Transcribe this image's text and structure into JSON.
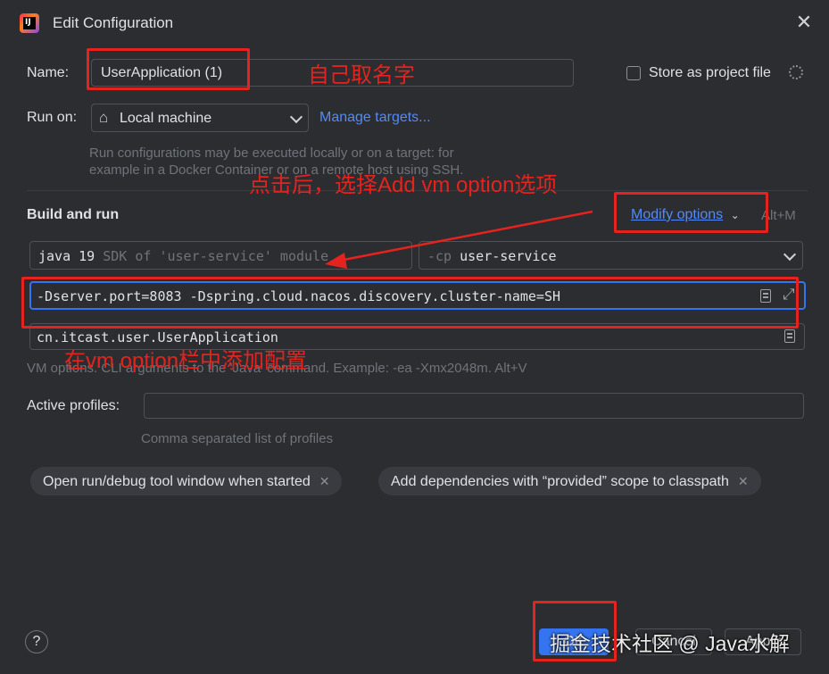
{
  "window": {
    "title": "Edit Configuration"
  },
  "name": {
    "label": "Name:",
    "value": "UserApplication (1)"
  },
  "store_as_project_file": {
    "label": "Store as project file",
    "checked": false
  },
  "run_on": {
    "label": "Run on:",
    "selected": "Local machine",
    "manage_targets": "Manage targets...",
    "hint_line1": "Run configurations may be executed locally or on a target: for",
    "hint_line2": "example in a Docker Container or on a remote host using SSH."
  },
  "build_and_run": {
    "heading": "Build and run",
    "modify_options": "Modify options",
    "modify_shortcut": "Alt+M",
    "jdk": {
      "java": "java",
      "version": "19",
      "desc": "SDK of 'user-service' module"
    },
    "classpath": {
      "flag": "-cp",
      "module": "user-service"
    },
    "vm_options": "-Dserver.port=8083 -Dspring.cloud.nacos.discovery.cluster-name=SH",
    "main_class": "cn.itcast.user.UserApplication",
    "vm_hint": "VM options. CLI arguments to the 'Java' command. Example: -ea -Xmx2048m. Alt+V"
  },
  "active_profiles": {
    "label": "Active profiles:",
    "value": "",
    "hint": "Comma separated list of profiles"
  },
  "chips": [
    {
      "label": "Open run/debug tool window when started"
    },
    {
      "label": "Add dependencies with “provided” scope to classpath"
    }
  ],
  "footer": {
    "help": "?",
    "ok_label": "OK",
    "cancel_label": "Cancel",
    "apply_label": "Apply",
    "watermark": "掘金技术社区 @ Java水解"
  },
  "annotations": {
    "name_note": "自己取名字",
    "modify_note": "点击后，选择Add vm option选项",
    "vm_note": "在vm option栏中添加配置"
  },
  "colors": {
    "background": "#2b2d30",
    "accent_blue": "#548af7",
    "focus_border": "#3574f0",
    "annotation_red": "#e5231e",
    "ok_button": "#3574f0"
  }
}
